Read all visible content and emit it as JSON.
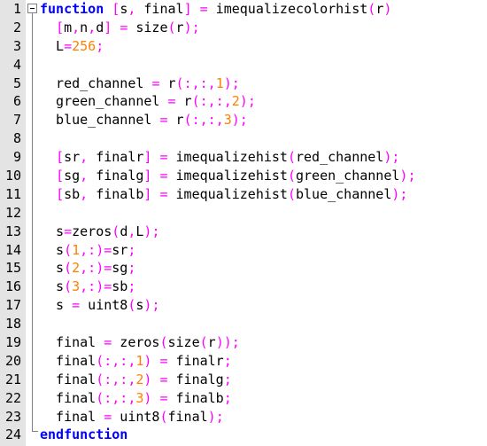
{
  "editor": {
    "colors": {
      "keyword": "#0000ff",
      "number": "#ff8000",
      "operator": "#ff00ff",
      "text": "#000000",
      "gutter": "#e4e4e4"
    },
    "fold_icon": "minus-box-icon",
    "lines": [
      {
        "n": "1",
        "tokens": [
          [
            "kw",
            "function"
          ],
          [
            "tk",
            " "
          ],
          [
            "op",
            "["
          ],
          [
            "tk",
            "s"
          ],
          [
            "op",
            ","
          ],
          [
            "tk",
            " final"
          ],
          [
            "op",
            "]"
          ],
          [
            "tk",
            " "
          ],
          [
            "op",
            "="
          ],
          [
            "tk",
            " imequalizecolorhist"
          ],
          [
            "op",
            "("
          ],
          [
            "tk",
            "r"
          ],
          [
            "op",
            ")"
          ]
        ]
      },
      {
        "n": "2",
        "tokens": [
          [
            "tk",
            "  "
          ],
          [
            "op",
            "["
          ],
          [
            "tk",
            "m"
          ],
          [
            "op",
            ","
          ],
          [
            "tk",
            "n"
          ],
          [
            "op",
            ","
          ],
          [
            "tk",
            "d"
          ],
          [
            "op",
            "]"
          ],
          [
            "tk",
            " "
          ],
          [
            "op",
            "="
          ],
          [
            "tk",
            " size"
          ],
          [
            "op",
            "("
          ],
          [
            "tk",
            "r"
          ],
          [
            "op",
            ")"
          ],
          [
            "op",
            ";"
          ]
        ]
      },
      {
        "n": "3",
        "tokens": [
          [
            "tk",
            "  L"
          ],
          [
            "op",
            "="
          ],
          [
            "num",
            "256"
          ],
          [
            "op",
            ";"
          ]
        ]
      },
      {
        "n": "4",
        "tokens": []
      },
      {
        "n": "5",
        "tokens": [
          [
            "tk",
            "  red_channel "
          ],
          [
            "op",
            "="
          ],
          [
            "tk",
            " r"
          ],
          [
            "op",
            "("
          ],
          [
            "op",
            ":,:,"
          ],
          [
            "num",
            "1"
          ],
          [
            "op",
            ")"
          ],
          [
            "op",
            ";"
          ]
        ]
      },
      {
        "n": "6",
        "tokens": [
          [
            "tk",
            "  green_channel "
          ],
          [
            "op",
            "="
          ],
          [
            "tk",
            " r"
          ],
          [
            "op",
            "("
          ],
          [
            "op",
            ":,:,"
          ],
          [
            "num",
            "2"
          ],
          [
            "op",
            ")"
          ],
          [
            "op",
            ";"
          ]
        ]
      },
      {
        "n": "7",
        "tokens": [
          [
            "tk",
            "  blue_channel "
          ],
          [
            "op",
            "="
          ],
          [
            "tk",
            " r"
          ],
          [
            "op",
            "("
          ],
          [
            "op",
            ":,:,"
          ],
          [
            "num",
            "3"
          ],
          [
            "op",
            ")"
          ],
          [
            "op",
            ";"
          ]
        ]
      },
      {
        "n": "8",
        "tokens": []
      },
      {
        "n": "9",
        "tokens": [
          [
            "tk",
            "  "
          ],
          [
            "op",
            "["
          ],
          [
            "tk",
            "sr"
          ],
          [
            "op",
            ","
          ],
          [
            "tk",
            " finalr"
          ],
          [
            "op",
            "]"
          ],
          [
            "tk",
            " "
          ],
          [
            "op",
            "="
          ],
          [
            "tk",
            " imequalizehist"
          ],
          [
            "op",
            "("
          ],
          [
            "tk",
            "red_channel"
          ],
          [
            "op",
            ")"
          ],
          [
            "op",
            ";"
          ]
        ]
      },
      {
        "n": "10",
        "tokens": [
          [
            "tk",
            "  "
          ],
          [
            "op",
            "["
          ],
          [
            "tk",
            "sg"
          ],
          [
            "op",
            ","
          ],
          [
            "tk",
            " finalg"
          ],
          [
            "op",
            "]"
          ],
          [
            "tk",
            " "
          ],
          [
            "op",
            "="
          ],
          [
            "tk",
            " imequalizehist"
          ],
          [
            "op",
            "("
          ],
          [
            "tk",
            "green_channel"
          ],
          [
            "op",
            ")"
          ],
          [
            "op",
            ";"
          ]
        ]
      },
      {
        "n": "11",
        "tokens": [
          [
            "tk",
            "  "
          ],
          [
            "op",
            "["
          ],
          [
            "tk",
            "sb"
          ],
          [
            "op",
            ","
          ],
          [
            "tk",
            " finalb"
          ],
          [
            "op",
            "]"
          ],
          [
            "tk",
            " "
          ],
          [
            "op",
            "="
          ],
          [
            "tk",
            " imequalizehist"
          ],
          [
            "op",
            "("
          ],
          [
            "tk",
            "blue_channel"
          ],
          [
            "op",
            ")"
          ],
          [
            "op",
            ";"
          ]
        ]
      },
      {
        "n": "12",
        "tokens": []
      },
      {
        "n": "13",
        "tokens": [
          [
            "tk",
            "  s"
          ],
          [
            "op",
            "="
          ],
          [
            "tk",
            "zeros"
          ],
          [
            "op",
            "("
          ],
          [
            "tk",
            "d"
          ],
          [
            "op",
            ","
          ],
          [
            "tk",
            "L"
          ],
          [
            "op",
            ")"
          ],
          [
            "op",
            ";"
          ]
        ]
      },
      {
        "n": "14",
        "tokens": [
          [
            "tk",
            "  s"
          ],
          [
            "op",
            "("
          ],
          [
            "num",
            "1"
          ],
          [
            "op",
            ",:)"
          ],
          [
            "op",
            "="
          ],
          [
            "tk",
            "sr"
          ],
          [
            "op",
            ";"
          ]
        ]
      },
      {
        "n": "15",
        "tokens": [
          [
            "tk",
            "  s"
          ],
          [
            "op",
            "("
          ],
          [
            "num",
            "2"
          ],
          [
            "op",
            ",:)"
          ],
          [
            "op",
            "="
          ],
          [
            "tk",
            "sg"
          ],
          [
            "op",
            ";"
          ]
        ]
      },
      {
        "n": "16",
        "tokens": [
          [
            "tk",
            "  s"
          ],
          [
            "op",
            "("
          ],
          [
            "num",
            "3"
          ],
          [
            "op",
            ",:)"
          ],
          [
            "op",
            "="
          ],
          [
            "tk",
            "sb"
          ],
          [
            "op",
            ";"
          ]
        ]
      },
      {
        "n": "17",
        "tokens": [
          [
            "tk",
            "  s "
          ],
          [
            "op",
            "="
          ],
          [
            "tk",
            " uint8"
          ],
          [
            "op",
            "("
          ],
          [
            "tk",
            "s"
          ],
          [
            "op",
            ")"
          ],
          [
            "op",
            ";"
          ]
        ]
      },
      {
        "n": "18",
        "tokens": []
      },
      {
        "n": "19",
        "tokens": [
          [
            "tk",
            "  final "
          ],
          [
            "op",
            "="
          ],
          [
            "tk",
            " zeros"
          ],
          [
            "op",
            "("
          ],
          [
            "tk",
            "size"
          ],
          [
            "op",
            "("
          ],
          [
            "tk",
            "r"
          ],
          [
            "op",
            "))"
          ],
          [
            "op",
            ";"
          ]
        ]
      },
      {
        "n": "20",
        "tokens": [
          [
            "tk",
            "  final"
          ],
          [
            "op",
            "("
          ],
          [
            "op",
            ":,:,"
          ],
          [
            "num",
            "1"
          ],
          [
            "op",
            ")"
          ],
          [
            "tk",
            " "
          ],
          [
            "op",
            "="
          ],
          [
            "tk",
            " finalr"
          ],
          [
            "op",
            ";"
          ]
        ]
      },
      {
        "n": "21",
        "tokens": [
          [
            "tk",
            "  final"
          ],
          [
            "op",
            "("
          ],
          [
            "op",
            ":,:,"
          ],
          [
            "num",
            "2"
          ],
          [
            "op",
            ")"
          ],
          [
            "tk",
            " "
          ],
          [
            "op",
            "="
          ],
          [
            "tk",
            " finalg"
          ],
          [
            "op",
            ";"
          ]
        ]
      },
      {
        "n": "22",
        "tokens": [
          [
            "tk",
            "  final"
          ],
          [
            "op",
            "("
          ],
          [
            "op",
            ":,:,"
          ],
          [
            "num",
            "3"
          ],
          [
            "op",
            ")"
          ],
          [
            "tk",
            " "
          ],
          [
            "op",
            "="
          ],
          [
            "tk",
            " finalb"
          ],
          [
            "op",
            ";"
          ]
        ]
      },
      {
        "n": "23",
        "tokens": [
          [
            "tk",
            "  final "
          ],
          [
            "op",
            "="
          ],
          [
            "tk",
            " uint8"
          ],
          [
            "op",
            "("
          ],
          [
            "tk",
            "final"
          ],
          [
            "op",
            ")"
          ],
          [
            "op",
            ";"
          ]
        ]
      },
      {
        "n": "24",
        "tokens": [
          [
            "kw",
            "endfunction"
          ]
        ]
      }
    ]
  }
}
